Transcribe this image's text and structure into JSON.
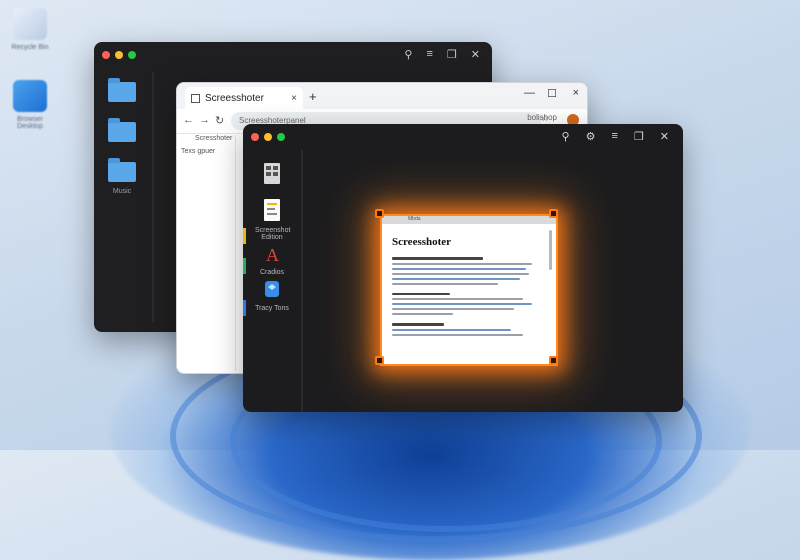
{
  "desktop": {
    "icons": [
      {
        "label": "Recycle Bin",
        "icon": "recycle-bin-icon"
      },
      {
        "label": "Browser Desktop",
        "icon": "browser-desktop-icon"
      }
    ]
  },
  "files_window": {
    "folders": [
      {
        "label": ""
      },
      {
        "label": ""
      },
      {
        "label": "Music"
      }
    ],
    "toolbar_icons": [
      "pin-icon",
      "filter-icon",
      "copy-icon",
      "close-icon"
    ]
  },
  "browser": {
    "tab_title": "Screesshoter",
    "tab_close": "×",
    "new_tab": "+",
    "minimize": "—",
    "maximize": "☐",
    "close": "×",
    "url_text": "Screesshoterpanel",
    "url_right": "bolishop",
    "sidebar_title": "Scresshoter",
    "sidebar_sub": "Texs gpuer"
  },
  "app": {
    "tools": [
      {
        "label": "",
        "icon": "grid-doc-icon"
      },
      {
        "label": "Screenshot Edition",
        "icon": "document-edit-icon"
      },
      {
        "label": "Cradios",
        "icon": "text-a-icon"
      },
      {
        "label": "Tracy Tons",
        "icon": "layers-icon"
      }
    ],
    "toolbar_icons": [
      "pin-icon",
      "settings-icon",
      "filter-icon",
      "crop-icon",
      "close-icon"
    ],
    "capture": {
      "bar_title": "Mbda",
      "title": "Screesshoter"
    }
  }
}
